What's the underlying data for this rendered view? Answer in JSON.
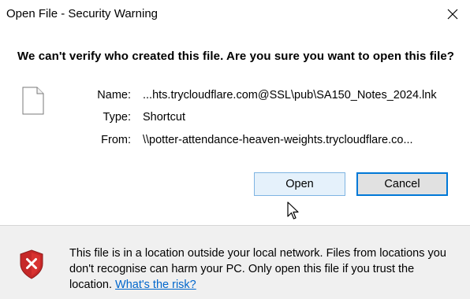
{
  "window": {
    "title": "Open File - Security Warning"
  },
  "dialog": {
    "headline": "We can't verify who created this file. Are you sure you want to open this file?",
    "fields": {
      "name_label": "Name:",
      "name_value": "...hts.trycloudflare.com@SSL\\pub\\SA150_Notes_2024.lnk",
      "type_label": "Type:",
      "type_value": "Shortcut",
      "from_label": "From:",
      "from_value": "\\\\potter-attendance-heaven-weights.trycloudflare.co..."
    },
    "buttons": {
      "open": "Open",
      "cancel": "Cancel"
    }
  },
  "footer": {
    "warning_text": "This file is in a location outside your local network. Files from locations you don't recognise can harm your PC. Only open this file if you trust the location.",
    "link_text": "What's the risk?"
  },
  "colors": {
    "link": "#0066cc",
    "cancel_border": "#0078d7",
    "open_background": "#e5f1fb",
    "shield_red": "#c62828"
  },
  "icons": [
    "close-icon",
    "file-icon",
    "shield-warning-icon",
    "mouse-cursor-icon"
  ]
}
